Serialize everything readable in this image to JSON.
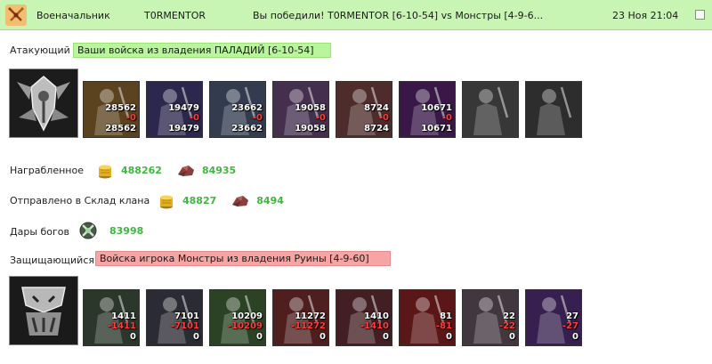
{
  "header": {
    "role": "Военачальник",
    "user": "T0RMENTOR",
    "subject": "Вы победили! T0RMENTOR [6-10-54] vs Монстры [4-9-6...",
    "date": "23 Ноя 21:04"
  },
  "attacker": {
    "label": "Атакующий",
    "banner": "Ваши войска из владения ПАЛАДИЙ [6-10-54]",
    "units": [
      {
        "name": "dwarf-unit",
        "count": "28562",
        "loss": "-0",
        "left": "28562",
        "bg": "#7a5a2a"
      },
      {
        "name": "swordsman-unit",
        "count": "19479",
        "loss": "-0",
        "left": "19479",
        "bg": "#3b3566"
      },
      {
        "name": "knight-unit",
        "count": "23662",
        "loss": "-0",
        "left": "23662",
        "bg": "#44506a"
      },
      {
        "name": "griffin-unit",
        "count": "19058",
        "loss": "-0",
        "left": "19058",
        "bg": "#5c3f6a"
      },
      {
        "name": "archer-unit",
        "count": "8724",
        "loss": "-0",
        "left": "8724",
        "bg": "#6a3b3b"
      },
      {
        "name": "sorceress-unit",
        "count": "10671",
        "loss": "-0",
        "left": "10671",
        "bg": "#4c2060"
      },
      {
        "name": "hooded-unit",
        "count": "",
        "loss": "",
        "left": "",
        "bg": "#4a4a4a"
      },
      {
        "name": "dark-rider-unit",
        "count": "",
        "loss": "",
        "left": "",
        "bg": "#3c3c3c"
      }
    ]
  },
  "loot": {
    "label": "Награбленное",
    "gold": "488262",
    "ore": "84935"
  },
  "clan": {
    "label": "Отправлено в Склад клана",
    "gold": "48827",
    "ore": "8494"
  },
  "gifts": {
    "label": "Дары богов",
    "value": "83998"
  },
  "defender": {
    "label": "Защищающийся",
    "banner": "Войска игрока Монстры из владения Руины [4-9-60]",
    "units": [
      {
        "name": "ogre-unit",
        "count": "1411",
        "loss": "-1411",
        "left": "0",
        "bg": "#3a4a3a"
      },
      {
        "name": "troll-unit",
        "count": "7101",
        "loss": "-7101",
        "left": "0",
        "bg": "#3a3a45"
      },
      {
        "name": "orc-unit",
        "count": "10209",
        "loss": "-10209",
        "left": "0",
        "bg": "#3a5a30"
      },
      {
        "name": "demon-unit",
        "count": "11272",
        "loss": "-11272",
        "left": "0",
        "bg": "#6a2a2a"
      },
      {
        "name": "spider-unit",
        "count": "1410",
        "loss": "-1410",
        "left": "0",
        "bg": "#5a2a30"
      },
      {
        "name": "dragon-unit",
        "count": "81",
        "loss": "-81",
        "left": "0",
        "bg": "#7a1f1f"
      },
      {
        "name": "golem-unit",
        "count": "22",
        "loss": "-22",
        "left": "0",
        "bg": "#5a4a55"
      },
      {
        "name": "beast-unit",
        "count": "27",
        "loss": "-27",
        "left": "0",
        "bg": "#4a2a6a"
      }
    ]
  },
  "colors": {
    "header_bg": "#c8f5b4",
    "attacker_banner": "#b8f59d",
    "defender_banner": "#f7a4a4",
    "value_green": "#3fb83f",
    "loss_red": "#ff3b3b"
  },
  "icons": {
    "logo": "crossed-swords-icon",
    "gold": "gold-coins-icon",
    "ore": "ore-icon",
    "gift": "gift-orb-icon"
  }
}
